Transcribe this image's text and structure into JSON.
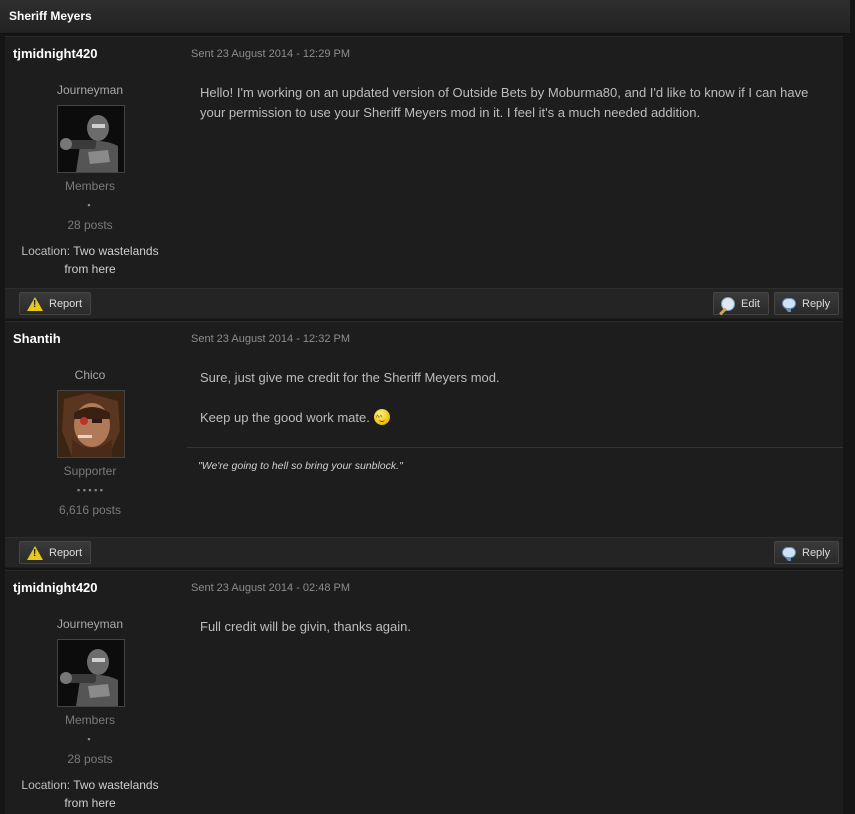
{
  "topic": {
    "title": "Sheriff Meyers"
  },
  "posts": [
    {
      "author": "tjmidnight420",
      "date": "Sent 23 August 2014 - 12:29 PM",
      "rank": "Journeyman",
      "group": "Members",
      "pips": "▪",
      "post_count": "28 posts",
      "location_label": "Location:",
      "location_line1": "Two wastelands",
      "location_line2": "from here",
      "message": [
        "Hello! I'm working on an updated version of Outside Bets by Moburma80, and I'd like to know if I can have your permission to use your Sheriff Meyers mod in it. I feel it's a much needed addition."
      ],
      "buttons": {
        "report": "Report",
        "edit": "Edit",
        "reply": "Reply"
      }
    },
    {
      "author": "Shantih",
      "date": "Sent 23 August 2014 - 12:32 PM",
      "rank": "Chico",
      "group": "Supporter",
      "pips": "▪ ▪ ▪ ▪ ▪",
      "post_count": "6,616 posts",
      "message": [
        "Sure, just give me credit for the Sheriff Meyers mod.",
        "Keep up the good work mate."
      ],
      "signature": "\"We're going to hell so bring your sunblock.\"",
      "buttons": {
        "report": "Report",
        "reply": "Reply"
      }
    },
    {
      "author": "tjmidnight420",
      "date": "Sent 23 August 2014 - 02:48 PM",
      "rank": "Journeyman",
      "group": "Members",
      "pips": "▪",
      "post_count": "28 posts",
      "location_label": "Location:",
      "location_line1": "Two wastelands",
      "location_line2": "from here",
      "message": [
        "Full credit will be givin, thanks again."
      ]
    }
  ],
  "icons": {
    "report": "warning-icon",
    "edit": "edit-icon",
    "reply": "speech-bubble-icon",
    "smiley": "smiley-icon"
  }
}
